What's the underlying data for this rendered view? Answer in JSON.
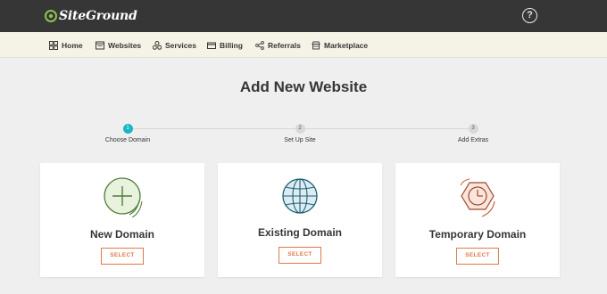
{
  "app": {
    "logo_text": "SiteGround",
    "help_label": "?"
  },
  "nav": {
    "items": [
      {
        "label": "Home",
        "icon": "grid-icon"
      },
      {
        "label": "Websites",
        "icon": "browser-icon"
      },
      {
        "label": "Services",
        "icon": "services-icon"
      },
      {
        "label": "Billing",
        "icon": "billing-icon"
      },
      {
        "label": "Referrals",
        "icon": "share-icon"
      },
      {
        "label": "Marketplace",
        "icon": "store-icon"
      }
    ]
  },
  "page": {
    "title": "Add New Website"
  },
  "stepper": {
    "steps": [
      {
        "number": "1",
        "label": "Choose Domain",
        "active": true
      },
      {
        "number": "2",
        "label": "Set Up Site",
        "active": false
      },
      {
        "number": "3",
        "label": "Add Extras",
        "active": false
      }
    ]
  },
  "cards": [
    {
      "title": "New Domain",
      "button": "SELECT",
      "icon": "plus-circle-icon"
    },
    {
      "title": "Existing Domain",
      "button": "SELECT",
      "icon": "globe-icon"
    },
    {
      "title": "Temporary Domain",
      "button": "SELECT",
      "icon": "clock-icon"
    }
  ],
  "colors": {
    "topbar": "#363636",
    "navbar": "#f5f3e6",
    "accent_step": "#1bb6c8",
    "button": "#e27849",
    "icon_green": "#7ab55c",
    "icon_teal": "#1e6b82",
    "icon_orange": "#d2603a"
  }
}
